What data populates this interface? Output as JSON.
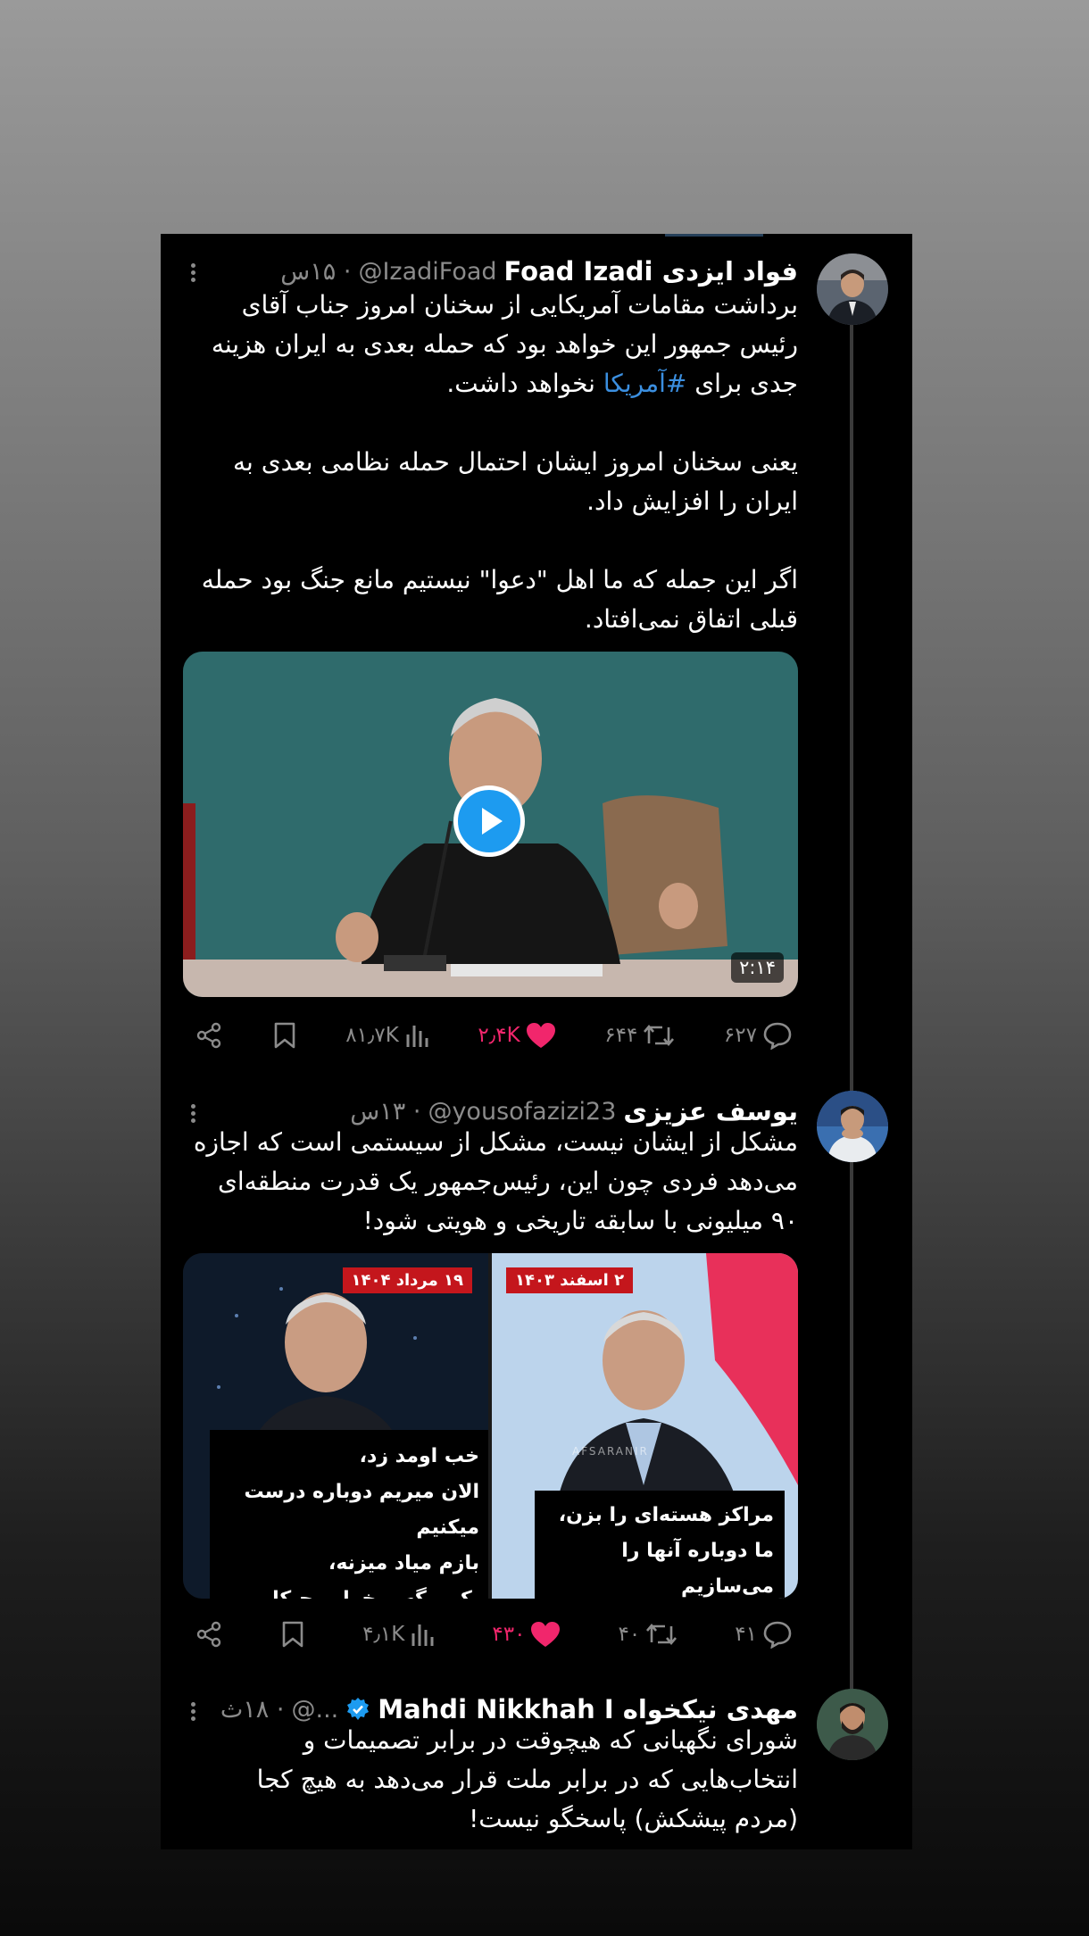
{
  "tweets": [
    {
      "name": "فواد ایزدی Foad Izadi",
      "handle": "@IzadiFoad",
      "time": "· ۱۵س",
      "paragraphs": [
        "برداشت مقامات آمریکایی از سخنان امروز جناب آقای رئیس جمهور این خواهد بود که حمله بعدی به ایران هزینه جدی برای",
        "یعنی سخنان امروز ایشان احتمال حمله نظامی بعدی به ایران را افزایش داد.",
        "اگر این جمله که ما اهل \"دعوا\" نیستیم مانع جنگ بود حمله قبلی اتفاق نمی‌افتاد."
      ],
      "hashtag": "#آمریکا",
      "after_hashtag": " نخواهد داشت.",
      "video_duration": "۲:۱۴",
      "actions": {
        "replies": "۶۲۷",
        "retweets": "۶۴۴",
        "likes": "۲٫۴K",
        "views": "۸۱٫۷K"
      }
    },
    {
      "name": "یوسف عزیزی",
      "handle": "@yousofazizi23",
      "time": "· ۱۳س",
      "paragraphs": [
        "مشکل از ایشان نیست، مشکل از سیستمی است که اجازه می‌دهد فردی چون این، رئیس‌جمهور یک قدرت منطقه‌ای ۹۰ میلیونی با سابقه تاریخی و هویتی شود!"
      ],
      "images": [
        {
          "date": "۲ اسفند ۱۴۰۳",
          "caption": "مراکز هسته‌ای را بزن،\nما دوباره آنها را می‌سازیم",
          "watermark": "AFSARANIR"
        },
        {
          "date": "۱۹ مرداد ۱۴۰۴",
          "caption": "خب اومد زد،\nالان میریم دوباره درست میکنیم\nبازم میاد میزنه،\nیکی بگه میخوایم چیکار کنیم؟"
        }
      ],
      "actions": {
        "replies": "۴۱",
        "retweets": "۴۰",
        "likes": "۴۳۰",
        "views": "۴٫۱K"
      }
    },
    {
      "name": "مهدی نیکخواه Mahdi Nikkhah I",
      "handle": "@...",
      "time": "· ۱۸ث",
      "paragraphs": [
        "شورای نگهبانی که هیچوقت در برابر تصمیمات و انتخاب‌هایی که در برابر ملت قرار می‌دهد به هیچ کجا (مردم پیشکش) پاسخگو نیست!"
      ]
    }
  ],
  "icons": [
    "reply-icon",
    "retweet-icon",
    "like-icon",
    "views-icon",
    "bookmark-icon",
    "share-icon",
    "more-icon",
    "verified-icon",
    "play-icon"
  ],
  "colors": {
    "accent": "#1d9bf0",
    "like": "#f1266c",
    "muted": "#8b8b8b",
    "hashtag": "#3b8fe0"
  }
}
